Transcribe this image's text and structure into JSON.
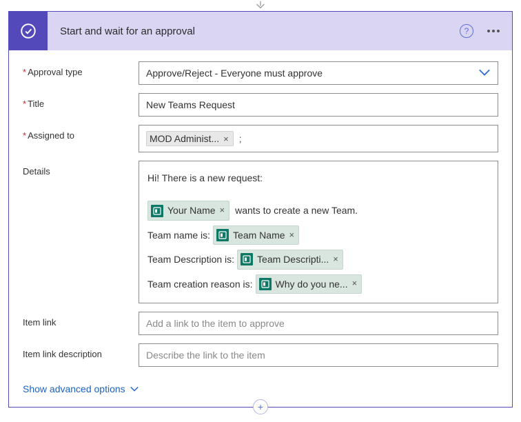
{
  "header": {
    "title": "Start and wait for an approval"
  },
  "fields": {
    "approvalType": {
      "label": "Approval type",
      "required": true,
      "value": "Approve/Reject - Everyone must approve"
    },
    "title": {
      "label": "Title",
      "required": true,
      "value": "New Teams Request"
    },
    "assignedTo": {
      "label": "Assigned to",
      "required": true,
      "chip": "MOD Administ..."
    },
    "details": {
      "label": "Details",
      "intro": "Hi! There is a new request:",
      "line1_chip": "Your Name",
      "line1_after": "wants to create a new Team.",
      "line2_text": "Team name is:",
      "line2_chip": "Team Name",
      "line3_text": "Team Description is:",
      "line3_chip": "Team Descripti...",
      "line4_text": "Team creation reason is:",
      "line4_chip": "Why do you ne..."
    },
    "itemLink": {
      "label": "Item link",
      "placeholder": "Add a link to the item to approve"
    },
    "itemLinkDesc": {
      "label": "Item link description",
      "placeholder": "Describe the link to the item"
    }
  },
  "advanced": {
    "label": "Show advanced options"
  }
}
